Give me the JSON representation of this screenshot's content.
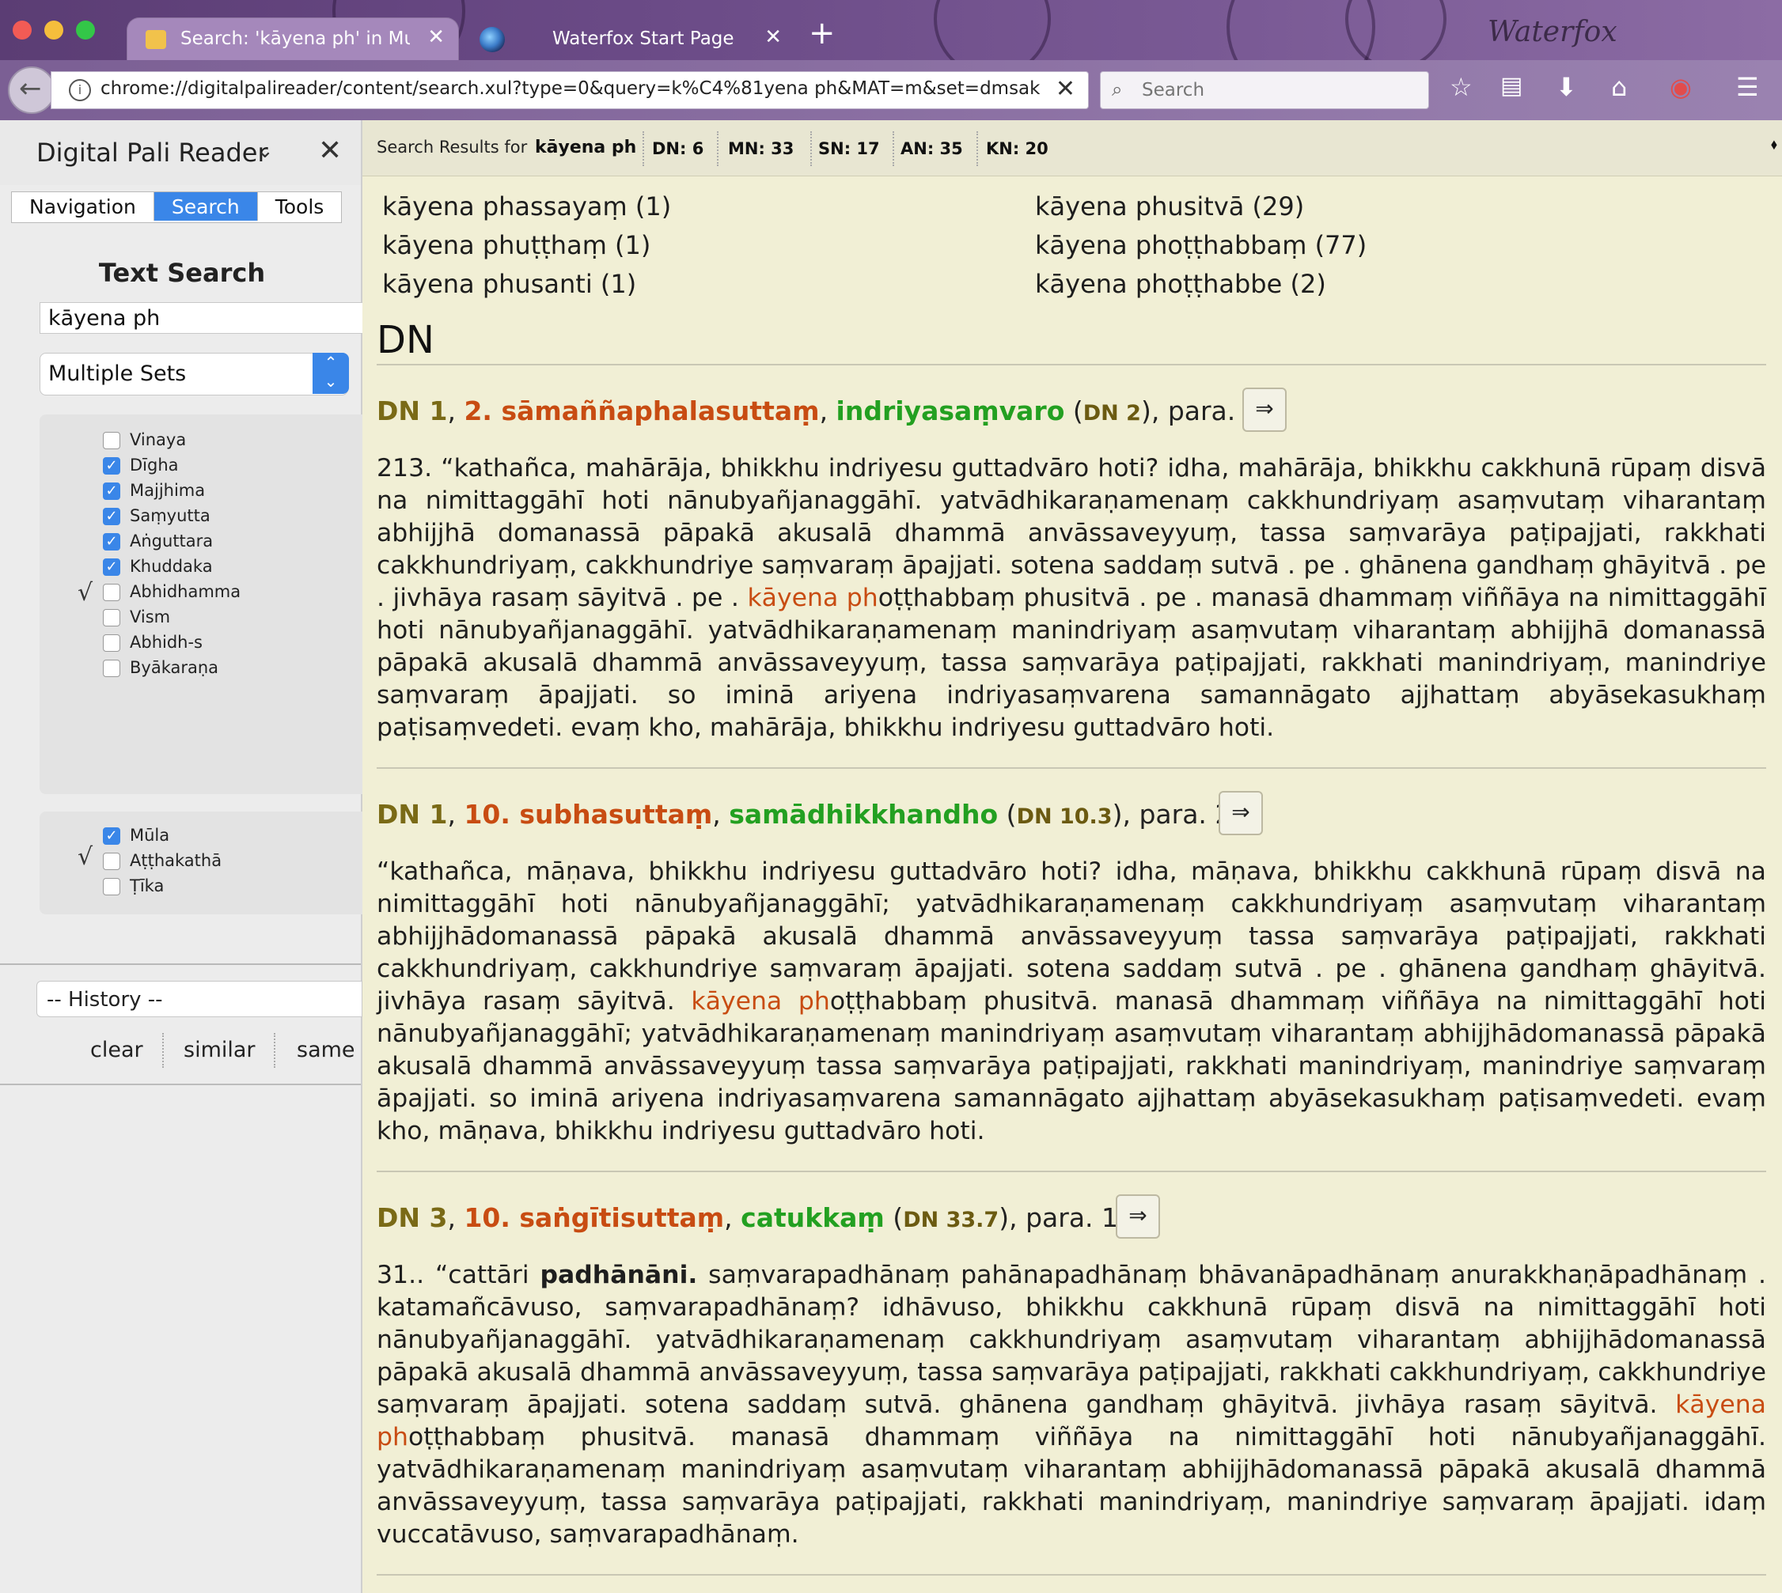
{
  "browser": {
    "active_tab_title": "Search: 'kāyena ph' in Multiple Sets",
    "second_tab_title": "Waterfox Start Page",
    "url": "chrome://digitalpalireader/content/search.xul?type=0&query=k%C4%81yena ph&MAT=m&set=dmsak",
    "search_placeholder": "Search",
    "signature": "Waterfox"
  },
  "sidebar": {
    "title": "Digital Pali Reader",
    "tabs": [
      "Navigation",
      "Search",
      "Tools"
    ],
    "text_search_title": "Text Search",
    "query_value": "kāyena ph",
    "set_select": "Multiple Sets",
    "sets": [
      {
        "label": "Vinaya",
        "checked": false
      },
      {
        "label": "Dīgha",
        "checked": true
      },
      {
        "label": "Majjhima",
        "checked": true
      },
      {
        "label": "Saṃyutta",
        "checked": true
      },
      {
        "label": "Aṅguttara",
        "checked": true
      },
      {
        "label": "Khuddaka",
        "checked": true
      },
      {
        "label": "Abhidhamma",
        "checked": false
      },
      {
        "label": "Vism",
        "checked": false
      },
      {
        "label": "Abhidh-s",
        "checked": false
      },
      {
        "label": "Byākaraṇa",
        "checked": false
      }
    ],
    "sets_tick": "√",
    "layers": [
      {
        "label": "Mūla",
        "checked": true
      },
      {
        "label": "Aṭṭhakathā",
        "checked": false
      },
      {
        "label": "Ṭīka",
        "checked": false
      }
    ],
    "layers_tick": "√",
    "history_label": "-- History --",
    "history_buttons": [
      "clear",
      "similar",
      "same"
    ]
  },
  "results": {
    "header_label": "Search Results for",
    "query": "kāyena ph",
    "counts": [
      "DN: 6",
      "MN: 33",
      "SN: 17",
      "AN: 35",
      "KN: 20"
    ],
    "toggle": "⬧",
    "variants_left": [
      "kāyena phassayaṃ (1)",
      "kāyena phuṭṭhaṃ (1)",
      "kāyena phusanti (1)"
    ],
    "variants_right": [
      "kāyena phusitvā (29)",
      "kāyena phoṭṭhabbaṃ (77)",
      "kāyena phoṭṭhabbe (2)"
    ],
    "section": "DN",
    "go_arrow": "⇒",
    "items": [
      {
        "book": "DN 1",
        "sutta": "2. sāmaññaphalasuttaṃ",
        "section": "indriyasaṃvaro",
        "ref": "DN 2",
        "para": "para. 1",
        "text_before": "213. “kathañca, mahārāja, bhikkhu indriyesu guttadvāro hoti? idha, mahārāja, bhikkhu cakkhunā rūpaṃ disvā na nimittaggāhī hoti nānubyañjanaggāhī. yatvādhikaraṇamenaṃ cakkhundriyaṃ asaṃvutaṃ viharantaṃ abhijjhā domanassā pāpakā akusalā dhammā anvāssaveyyuṃ, tassa saṃvarāya paṭipajjati, rakkhati cakkhundriyaṃ, cakkhundriye saṃvaraṃ āpajjati. sotena saddaṃ sutvā . pe . ghānena gandhaṃ ghāyitvā . pe . jivhāya rasaṃ sāyitvā . pe . ",
        "hit": "kāyena ph",
        "text_after": "oṭṭhabbaṃ phusitvā . pe . manasā dhammaṃ viññāya na nimittaggāhī hoti nānubyañjanaggāhī. yatvādhikaraṇamenaṃ manindriyaṃ asaṃvutaṃ viharantaṃ abhijjhā domanassā pāpakā akusalā dhammā anvāssaveyyuṃ, tassa saṃvarāya paṭipajjati, rakkhati manindriyaṃ, manindriye saṃvaraṃ āpajjati. so iminā ariyena indriyasaṃvarena samannāgato ajjhattaṃ abyāsekasukhaṃ paṭisaṃvedeti. evaṃ kho, mahārāja, bhikkhu indriyesu guttadvāro hoti."
      },
      {
        "book": "DN 1",
        "sutta": "10. subhasuttaṃ",
        "section": "samādhikkhandho",
        "ref": "DN 10.3",
        "para": "para. 2",
        "text_before": "“kathañca, māṇava, bhikkhu indriyesu guttadvāro hoti? idha, māṇava, bhikkhu cakkhunā rūpaṃ disvā na nimittaggāhī hoti nānubyañjanaggāhī; yatvādhikaraṇamenaṃ cakkhundriyaṃ asaṃvutaṃ viharantaṃ abhijjhādomanassā pāpakā akusalā dhammā anvāssaveyyuṃ tassa saṃvarāya paṭipajjati, rakkhati cakkhundriyaṃ, cakkhundriye saṃvaraṃ āpajjati. sotena saddaṃ sutvā . pe . ghānena gandhaṃ ghāyitvā. jivhāya rasaṃ sāyitvā. ",
        "hit": "kāyena ph",
        "text_after": "oṭṭhabbaṃ phusitvā. manasā dhammaṃ viññāya na nimittaggāhī hoti nānubyañjanaggāhī; yatvādhikaraṇamenaṃ manindriyaṃ asaṃvutaṃ viharantaṃ abhijjhādomanassā pāpakā akusalā dhammā anvāssaveyyuṃ tassa saṃvarāya paṭipajjati, rakkhati manindriyaṃ, manindriye saṃvaraṃ āpajjati. so iminā ariyena indriyasaṃvarena samannāgato ajjhattaṃ abyāsekasukhaṃ paṭisaṃvedeti. evaṃ kho, māṇava, bhikkhu indriyesu guttadvāro hoti."
      },
      {
        "book": "DN 3",
        "sutta": "10. saṅgītisuttaṃ",
        "section": "catukkaṃ",
        "ref": "DN 33.7",
        "para": "para. 18",
        "text_lead": "31.. “cattāri ",
        "text_bold": "padhānāni.",
        "text_before": " saṃvarapadhānaṃ pahānapadhānaṃ bhāvanāpadhānaṃ anurakkhaṇāpadhānaṃ . katamañcāvuso, saṃvarapadhānaṃ? idhāvuso, bhikkhu cakkhunā rūpaṃ disvā na nimittaggāhī hoti nānubyañjanaggāhī. yatvādhikaraṇamenaṃ cakkhundriyaṃ asaṃvutaṃ viharantaṃ abhijjhādomanassā pāpakā akusalā dhammā anvāssaveyyuṃ, tassa saṃvarāya paṭipajjati, rakkhati cakkhundriyaṃ, cakkhundriye saṃvaraṃ āpajjati. sotena saddaṃ sutvā. ghānena gandhaṃ ghāyitvā. jivhāya rasaṃ sāyitvā. ",
        "hit": "kāyena ph",
        "text_after": "oṭṭhabbaṃ phusitvā. manasā dhammaṃ viññāya na nimittaggāhī hoti nānubyañjanaggāhī. yatvādhikaraṇamenaṃ manindriyaṃ asaṃvutaṃ viharantaṃ abhijjhādomanassā pāpakā akusalā dhammā anvāssaveyyuṃ, tassa saṃvarāya paṭipajjati, rakkhati manindriyaṃ, manindriye saṃvaraṃ āpajjati. idaṃ vuccatāvuso, saṃvarapadhānaṃ."
      }
    ]
  },
  "colors": {
    "accent": "#3a86e8",
    "hit": "#c84c12",
    "section_green": "#23a021",
    "chrome_purple": "#6a4a86"
  }
}
